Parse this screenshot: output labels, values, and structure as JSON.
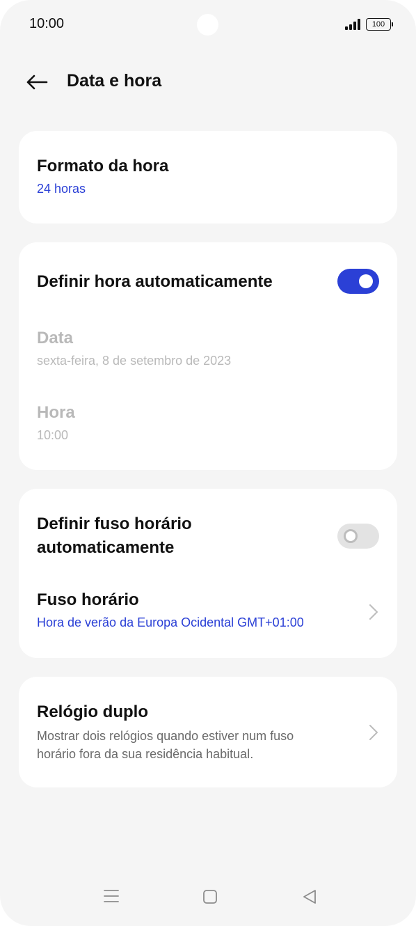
{
  "status_bar": {
    "time": "10:00",
    "battery": "100",
    "icons": [
      "signal-icon",
      "battery-icon"
    ]
  },
  "header": {
    "title": "Data e hora",
    "back_icon": "arrow-left-icon"
  },
  "time_format": {
    "title": "Formato da hora",
    "value": "24 horas"
  },
  "auto_time": {
    "title": "Definir hora automaticamente",
    "enabled": true,
    "date_title": "Data",
    "date_value": "sexta-feira, 8 de setembro de 2023",
    "time_title": "Hora",
    "time_value": "10:00"
  },
  "timezone": {
    "auto_title_line1": "Definir fuso horário",
    "auto_title_line2": "automaticamente",
    "auto_enabled": false,
    "title": "Fuso horário",
    "value": "Hora de verão da Europa Ocidental GMT+01:00"
  },
  "dual_clock": {
    "title": "Relógio duplo",
    "description_line1": "Mostrar dois relógios quando estiver num fuso",
    "description_line2": "horário fora da sua residência habitual."
  },
  "nav_bar": {
    "icons": [
      "menu-icon",
      "home-icon",
      "back-triangle-icon"
    ]
  },
  "colors": {
    "accent": "#2b40d6",
    "background": "#f5f5f5",
    "card": "#ffffff",
    "disabled_text": "#b9b9b9"
  }
}
